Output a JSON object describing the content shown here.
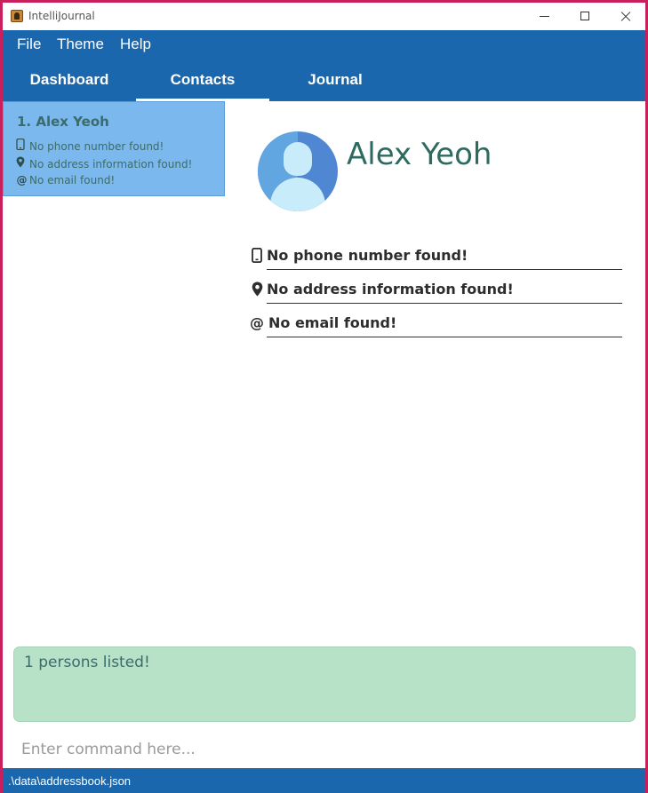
{
  "window": {
    "title": "IntelliJournal",
    "controls": {
      "minimize": "minimize",
      "maximize": "maximize",
      "close": "close"
    }
  },
  "menu": {
    "file": "File",
    "theme": "Theme",
    "help": "Help"
  },
  "tabs": [
    {
      "label": "Dashboard",
      "active": false
    },
    {
      "label": "Contacts",
      "active": true
    },
    {
      "label": "Journal",
      "active": false
    }
  ],
  "contact_list": [
    {
      "index_name": "1.  Alex Yeoh",
      "phone": "No phone number found!",
      "address": "No address information found!",
      "email": "No email found!"
    }
  ],
  "detail": {
    "name": "Alex Yeoh",
    "phone": "No phone number found!",
    "address": "No address information found!",
    "email": "No email found!"
  },
  "icons": {
    "phone": "phone-icon",
    "address": "map-pin-icon",
    "email": "at-icon"
  },
  "result": {
    "message": "1 persons listed!"
  },
  "command": {
    "placeholder": "Enter command here...",
    "value": ""
  },
  "status": {
    "path": ".\\data\\addressbook.json"
  },
  "colors": {
    "header_blue": "#1a67ad",
    "selected_card": "#7bb8ee",
    "result_bg": "#b8e2c8",
    "name_teal": "#2e6a60"
  }
}
